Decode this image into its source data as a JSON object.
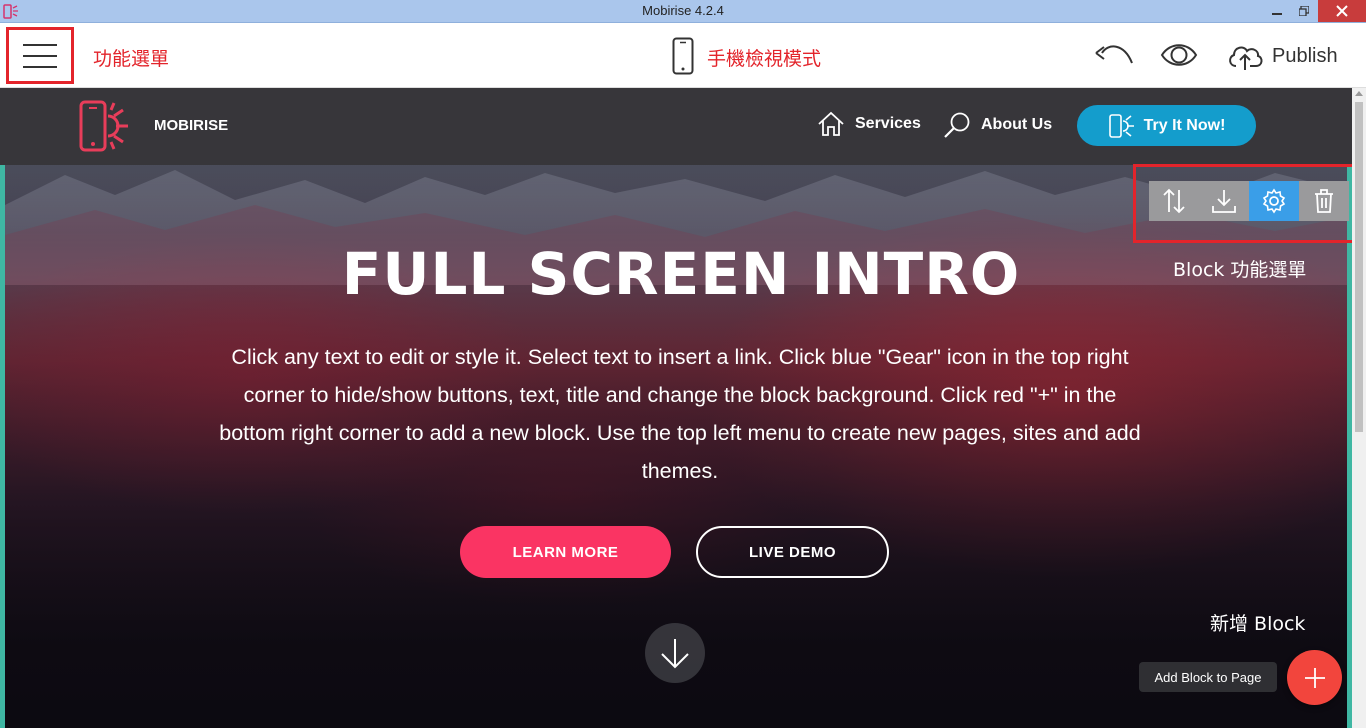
{
  "window": {
    "title": "Mobirise 4.2.4"
  },
  "toolbar": {
    "menu_annotation": "功能選單",
    "mobile_view_annotation": "手機檢視模式",
    "publish_label": "Publish",
    "icons": [
      "menu-icon",
      "phone-view-icon",
      "undo-icon",
      "preview-eye-icon",
      "cloud-upload-icon"
    ]
  },
  "site": {
    "brand": "MOBIRISE",
    "nav": [
      {
        "label": "Services",
        "icon": "home-icon"
      },
      {
        "label": "About Us",
        "icon": "search-icon"
      }
    ],
    "cta": "Try It Now!",
    "hero": {
      "title": "FULL SCREEN INTRO",
      "text": "Click any text to edit or style it. Select text to insert a link. Click blue \"Gear\" icon in the top right corner to hide/show buttons, text, title and change the block background. Click red \"+\" in the bottom right corner to add a new block. Use the top left menu to create new pages, sites and add themes.",
      "button_primary": "LEARN MORE",
      "button_secondary": "LIVE DEMO"
    }
  },
  "block_tools": {
    "annotation": "Block 功能選單",
    "tools": [
      "move-icon",
      "save-block-icon",
      "gear-icon",
      "trash-icon"
    ]
  },
  "add_block": {
    "annotation": "新增 Block",
    "tooltip": "Add Block to Page"
  },
  "colors": {
    "annotation_red": "#e3242b",
    "try_button": "#149dcc",
    "learn_more": "#fa3463",
    "gear_active": "#3a9ee8",
    "add_button": "#f2453d",
    "block_border": "#3fb7a3"
  }
}
